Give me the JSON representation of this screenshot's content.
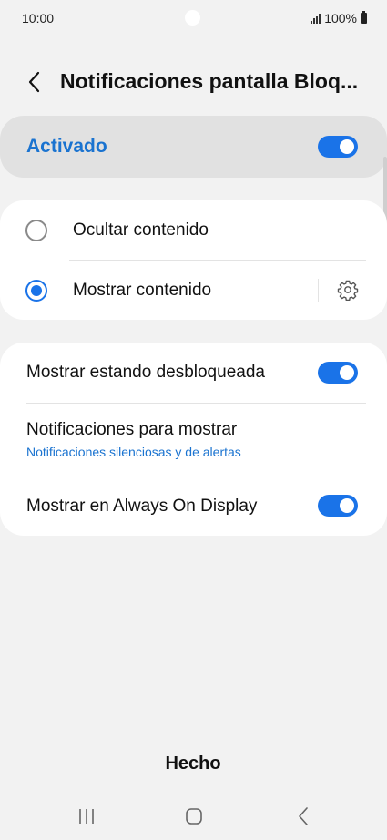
{
  "status_bar": {
    "time": "10:00",
    "battery": "100%"
  },
  "header": {
    "title": "Notificaciones pantalla Bloq..."
  },
  "master": {
    "label": "Activado",
    "enabled": true
  },
  "content_options": [
    {
      "label": "Ocultar contenido",
      "selected": false
    },
    {
      "label": "Mostrar contenido",
      "selected": true
    }
  ],
  "settings": {
    "unlocked": {
      "label": "Mostrar estando desbloqueada",
      "enabled": true
    },
    "notifications": {
      "label": "Notificaciones para mostrar",
      "sub": "Notificaciones silenciosas y de alertas"
    },
    "aod": {
      "label": "Mostrar en Always On Display",
      "enabled": true
    }
  },
  "footer": {
    "done_label": "Hecho"
  },
  "colors": {
    "accent": "#1a73e8",
    "background": "#f2f2f2",
    "card": "#ffffff"
  }
}
